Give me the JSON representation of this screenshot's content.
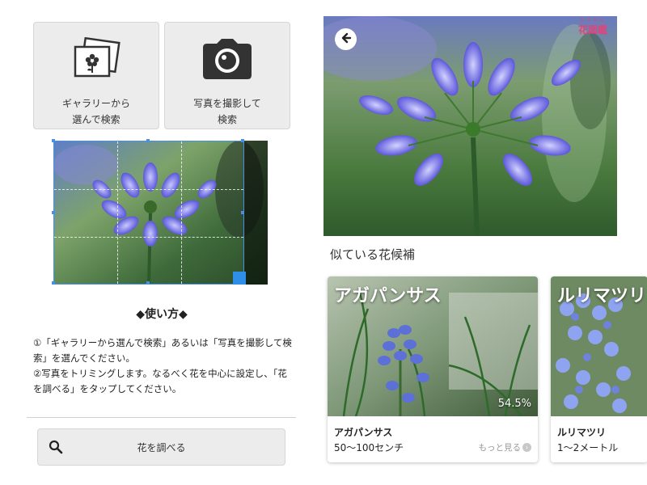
{
  "left": {
    "gallery_button": {
      "label": "ギャラリーから\n選んで検索",
      "icon": "photo-gallery-icon"
    },
    "camera_button": {
      "label": "写真を撮影して\n検索",
      "icon": "camera-icon"
    },
    "howto": {
      "title": "◆使い方◆",
      "step1": "①「ギャラリーから選んで検索」あるいは「写真を撮影して検索」を選んでください。",
      "step2": "②写真をトリミングします。なるべく花を中心に設定し、「花を調べる」をタップしてください。"
    },
    "search_button": {
      "label": "花を調べる",
      "icon": "search-icon"
    }
  },
  "right": {
    "back_icon": "arrow-left-icon",
    "logo": {
      "ruby": "かずかん",
      "text": "花図鑑"
    },
    "similar_title": "似ている花候補",
    "cards": [
      {
        "overlay_name": "アガパンサス",
        "percent": "54.5%",
        "name": "アガパンサス",
        "size": "50〜100センチ",
        "more": "もっと見る"
      },
      {
        "overlay_name": "ルリマツリ",
        "name": "ルリマツリ",
        "size": "1〜2メートル"
      }
    ]
  },
  "colors": {
    "accent": "#2f8fe8",
    "logo": "#e0447a",
    "tile_bg": "#ececec"
  }
}
